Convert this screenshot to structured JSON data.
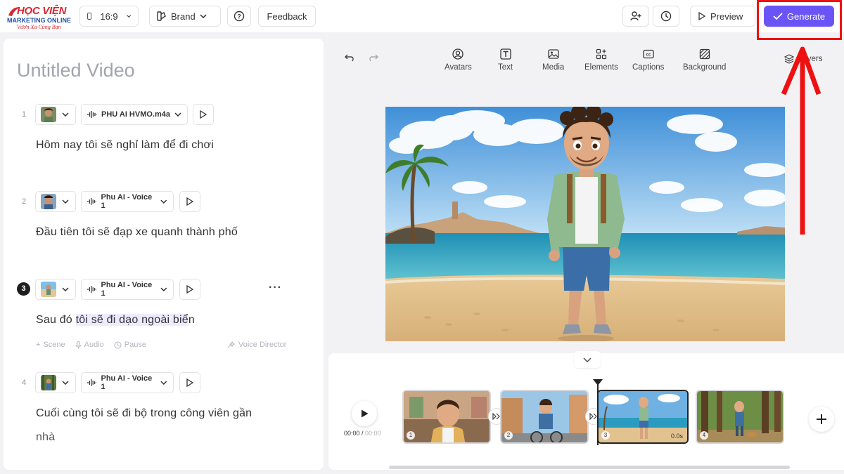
{
  "topbar": {
    "logo": {
      "main": "HỌC VIỆN",
      "sub": "MARKETING ONLINE",
      "tag": "Vươn Xa Cùng Bạn"
    },
    "aspect_label": "16:9",
    "brand_label": "Brand",
    "feedback_label": "Feedback",
    "preview_label": "Preview",
    "generate_label": "Generate",
    "highlight_color": "#ee1111",
    "accent_color": "#6b54f6"
  },
  "editor": {
    "title": "Untitled Video",
    "scenes": [
      {
        "num": "1",
        "voice": "PHU AI HVMO.m4a",
        "text": "Hôm nay tôi sẽ nghỉ làm để đi chơi"
      },
      {
        "num": "2",
        "voice": "Phu AI - Voice 1",
        "text": "Đầu tiên tôi sẽ đạp xe quanh thành phố"
      },
      {
        "num": "3",
        "voice": "Phu AI - Voice 1",
        "text_before": "Sau đó ",
        "text_highlight": "tôi sẽ đi dạo ngoài biể",
        "text_after": "n"
      },
      {
        "num": "4",
        "voice": "Phu AI - Voice 1",
        "text": "Cuối cùng tôi sẽ đi bộ trong công viên gần",
        "text_line2": "nhà"
      }
    ],
    "scene_tools": {
      "scene": "Scene",
      "audio": "Audio",
      "pause": "Pause",
      "voice_director": "Voice Director"
    }
  },
  "toolbar": {
    "avatars": "Avatars",
    "text": "Text",
    "media": "Media",
    "elements": "Elements",
    "captions": "Captions",
    "background": "Background",
    "layers": "Layers"
  },
  "timeline": {
    "current_time": "00:00",
    "total_time": "00:00",
    "clips": [
      {
        "num": "1"
      },
      {
        "num": "2"
      },
      {
        "num": "3",
        "duration": "0.0s"
      },
      {
        "num": "4"
      }
    ]
  }
}
